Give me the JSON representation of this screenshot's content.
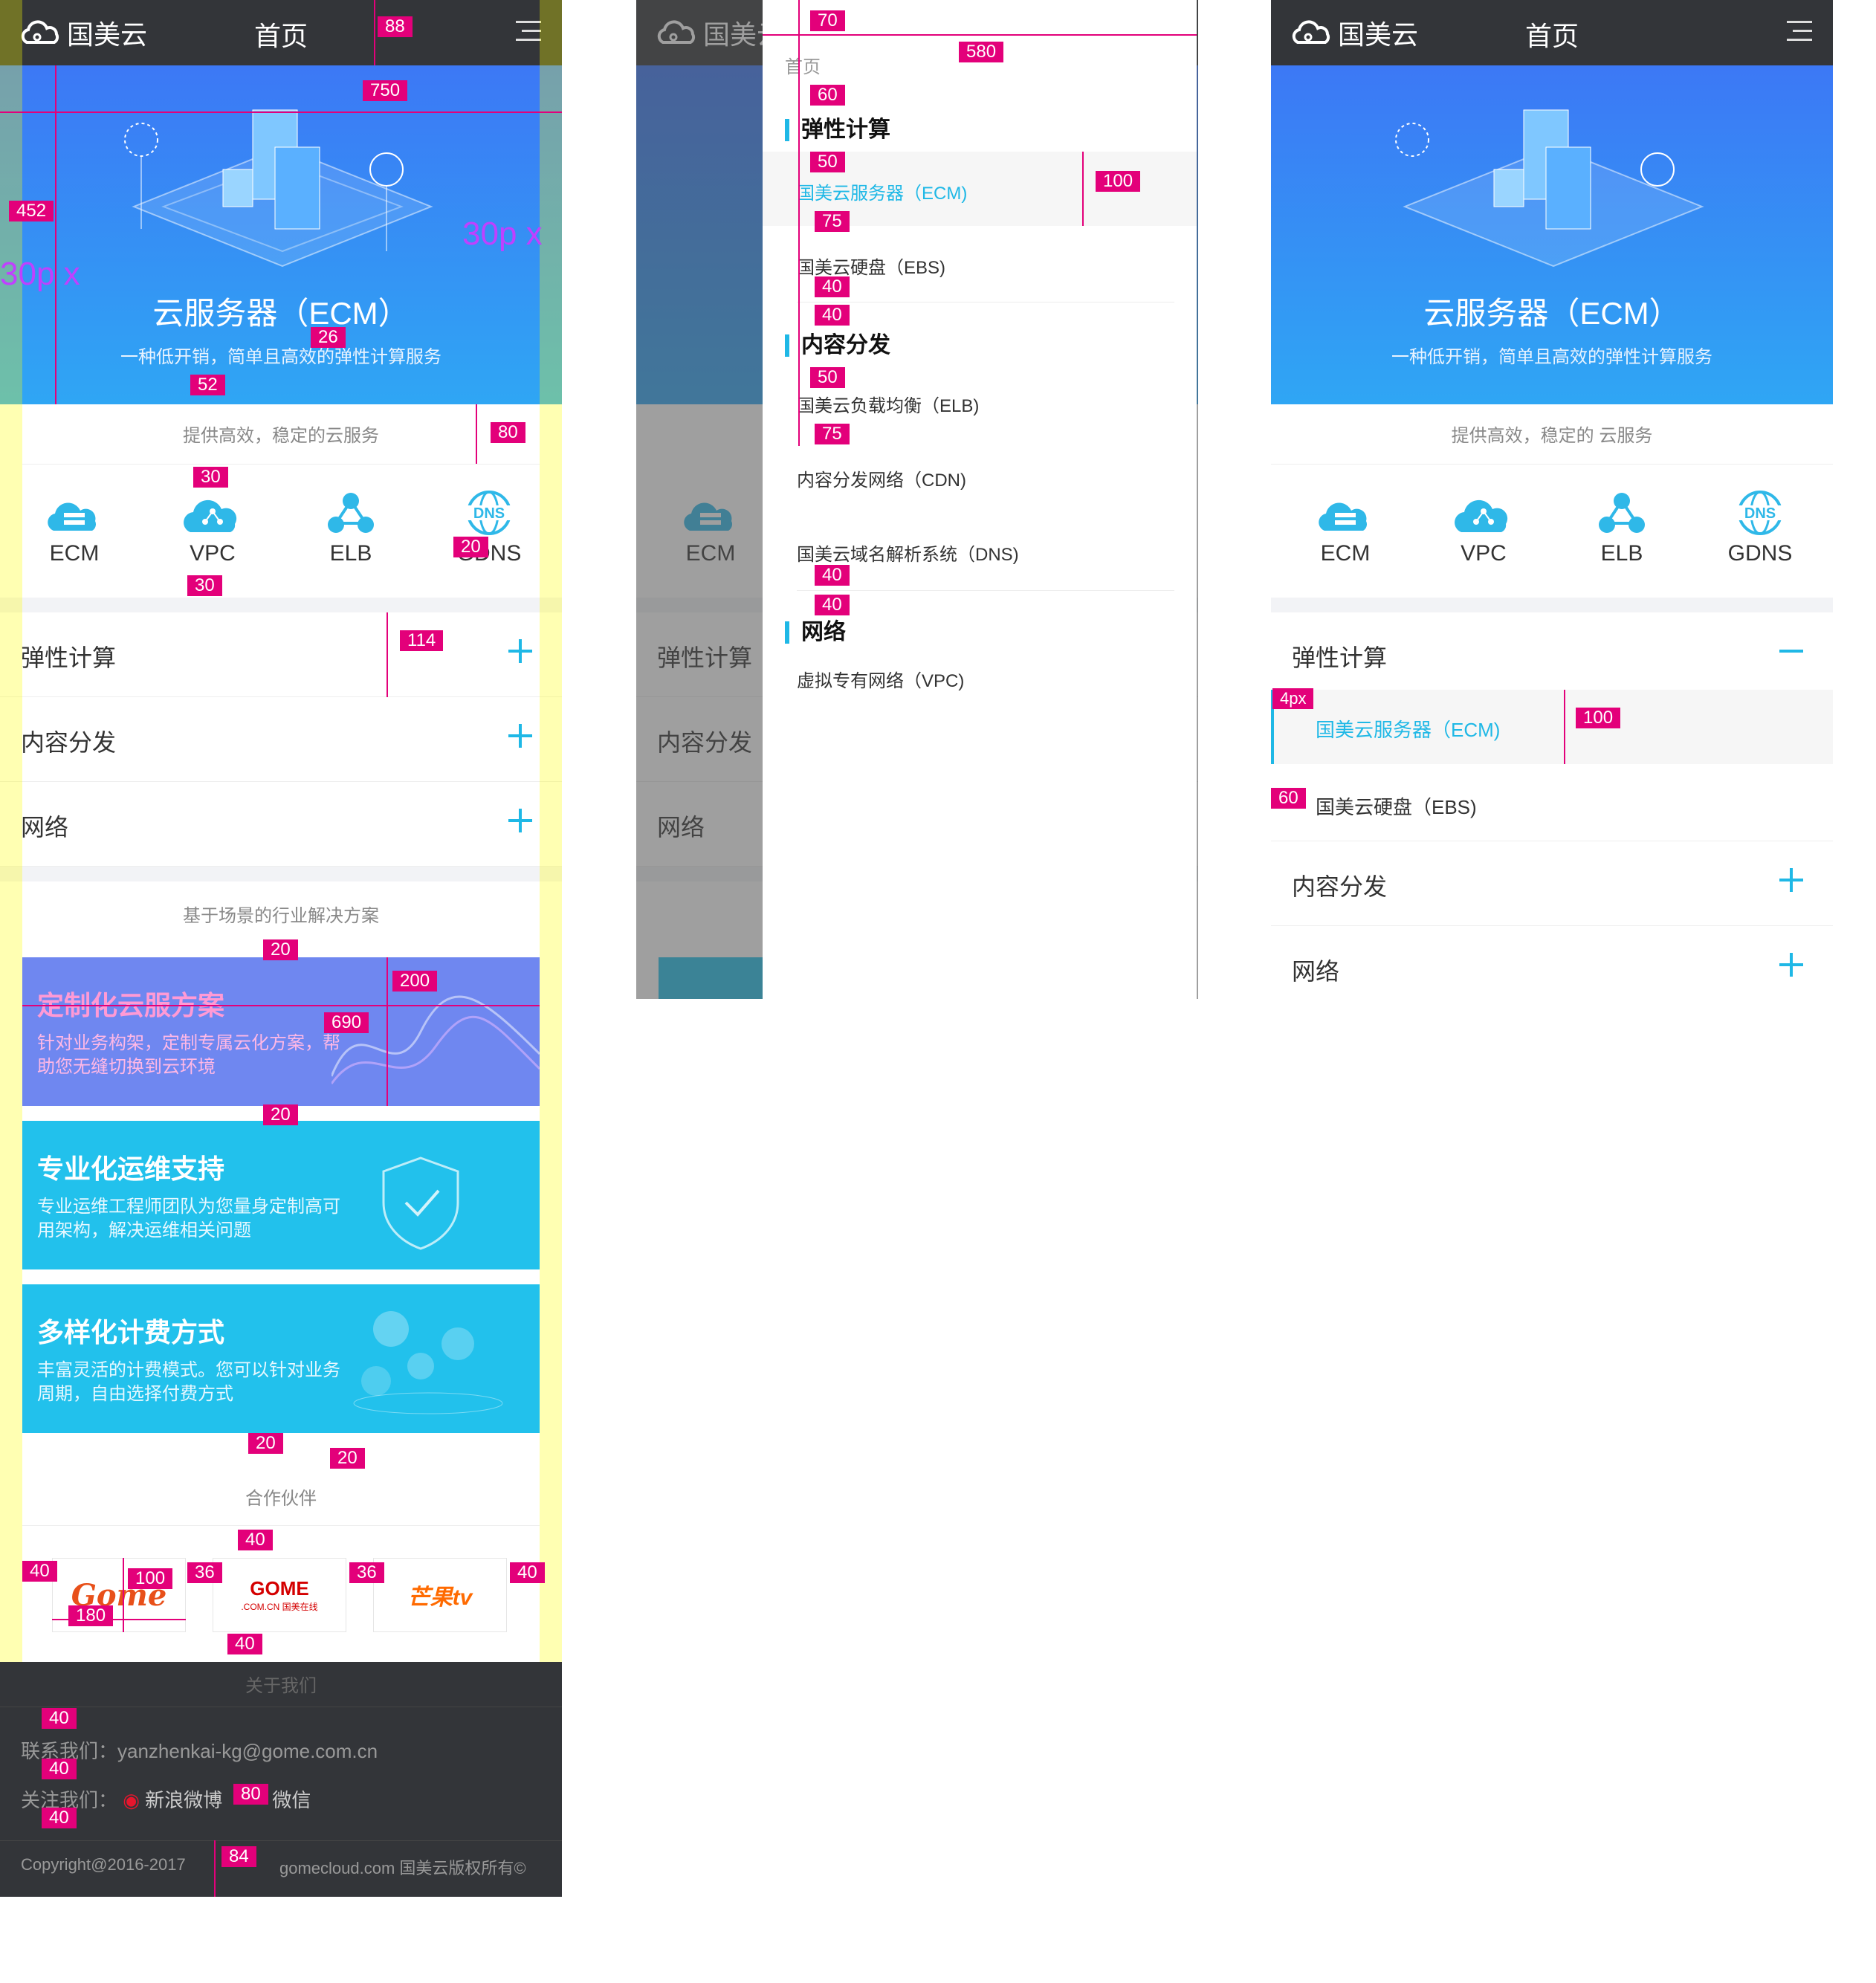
{
  "brand": {
    "logo_text": "国美云",
    "header_title": "首页"
  },
  "banner": {
    "title": "云服务器（ECM）",
    "subtitle": "一种低开销，简单且高效的弹性计算服务"
  },
  "services_heading": "提供高效，稳定的云服务",
  "services_heading_right": "提供高效，稳定的 云服务",
  "products": [
    {
      "label": "ECM",
      "icon": "cloud-server-icon"
    },
    {
      "label": "VPC",
      "icon": "cloud-network-icon"
    },
    {
      "label": "ELB",
      "icon": "load-balancer-icon"
    },
    {
      "label": "GDNS",
      "icon": "dns-globe-icon"
    }
  ],
  "accordion": [
    {
      "label": "弹性计算"
    },
    {
      "label": "内容分发"
    },
    {
      "label": "网络"
    }
  ],
  "accordion_expanded": {
    "children": [
      "国美云服务器（ECM)",
      "国美云硬盘（EBS)"
    ]
  },
  "solutions_heading": "基于场景的行业解决方案",
  "solutions": [
    {
      "title": "定制化云服方案",
      "desc": "针对业务构架，定制专属云化方案，帮助您无缝切换到云环境",
      "color": "#6f87f0"
    },
    {
      "title": "专业化运维支持",
      "desc": "专业运维工程师团队为您量身定制高可用架构，解决运维相关问题",
      "color": "#22c1ec"
    },
    {
      "title": "多样化计费方式",
      "desc": "丰富灵活的计费模式。您可以针对业务周期，自由选择付费方式",
      "color": "#22c1ec"
    }
  ],
  "partners_heading": "合作伙伴",
  "partners": [
    {
      "name": "Gome",
      "text": "Gome"
    },
    {
      "name": "GOME 国美在线",
      "text": "GOME",
      "sub": ".COM.CN 国美在线"
    },
    {
      "name": "芒果tv",
      "text": "芒果tv"
    }
  ],
  "footer": {
    "about": "关于我们",
    "contact": "联系我们：yanzhenkai-kg@gome.com.cn",
    "follow_label": "关注我们：",
    "weibo": "新浪微博",
    "wechat": "微信",
    "copyright_left": "Copyright@2016-2017",
    "copyright_right": "gomecloud.com 国美云版权所有©"
  },
  "drawer": {
    "home": "首页",
    "groups": [
      {
        "title": "弹性计算",
        "items": [
          "国美云服务器（ECM)",
          "国美云硬盘（EBS)"
        ]
      },
      {
        "title": "内容分发",
        "items": [
          "国美云负载均衡（ELB)",
          "内容分发网络（CDN)",
          "国美云域名解析系统（DNS)"
        ]
      },
      {
        "title": "网络",
        "items": [
          "虚拟专有网络（VPC)"
        ]
      }
    ]
  },
  "annotations": {
    "a88": "88",
    "a750": "750",
    "a452": "452",
    "a30px_l": "30p x",
    "a30px_r": "30p x",
    "a26": "26",
    "a52": "52",
    "a80": "80",
    "a30a": "30",
    "a30b": "30",
    "a20g": "20",
    "a114": "114",
    "a20a": "20",
    "a200": "200",
    "a690": "690",
    "a20b": "20",
    "a20c": "20",
    "a20d": "20",
    "a40t": "40",
    "a40l": "40",
    "a100": "100",
    "a36a": "36",
    "a36b": "36",
    "a40r": "40",
    "a180": "180",
    "a40b": "40",
    "f40a": "40",
    "f40b": "40",
    "f80": "80",
    "f40c": "40",
    "f84": "84",
    "d70": "70",
    "d580": "580",
    "d60": "60",
    "d50a": "50",
    "d100": "100",
    "d75a": "75",
    "d40a": "40",
    "d40b": "40",
    "d50b": "50",
    "d75b": "75",
    "d40c": "40",
    "d40d": "40",
    "r4px": "4px",
    "r100": "100",
    "r60": "60"
  },
  "colors": {
    "accent": "#1fb8e6",
    "header": "#333539",
    "annotation": "#e3007a"
  }
}
